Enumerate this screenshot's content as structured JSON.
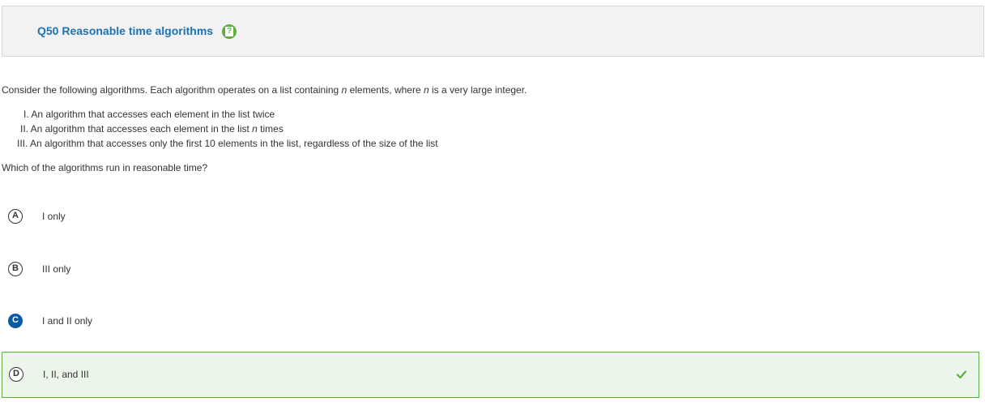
{
  "question": {
    "title": "Q50 Reasonable time algorithms",
    "help_icon": "question-mark-help-icon",
    "stem_part1": "Consider the following algorithms. Each algorithm operates on a list containing ",
    "stem_var1": "n",
    "stem_part2": " elements, where ",
    "stem_var2": "n",
    "stem_part3": " is a very large integer.",
    "statements": [
      {
        "text": "I. An algorithm that accesses each element in the list twice"
      },
      {
        "text_before": "II. An algorithm that accesses each element in the list ",
        "var": "n",
        "text_after": " times"
      },
      {
        "text": "III. An algorithm that accesses only the first 10 elements in the list, regardless of the size of the list"
      }
    ],
    "ask": "Which of the algorithms run in reasonable time?"
  },
  "choices": [
    {
      "letter": "A",
      "text": "I only",
      "selected": false,
      "correct": false
    },
    {
      "letter": "B",
      "text": "III only",
      "selected": false,
      "correct": false
    },
    {
      "letter": "C",
      "text": "I and II only",
      "selected": true,
      "correct": false
    },
    {
      "letter": "D",
      "text": "I, II, and III",
      "selected": false,
      "correct": true
    }
  ],
  "colors": {
    "title": "#1c73b4",
    "help_badge": "#5fae3f",
    "selected": "#0a5aa3",
    "correct_border": "#5fae3f",
    "correct_bg": "#ebf5e9"
  },
  "icons": {
    "correct_check": "checkmark-icon"
  }
}
